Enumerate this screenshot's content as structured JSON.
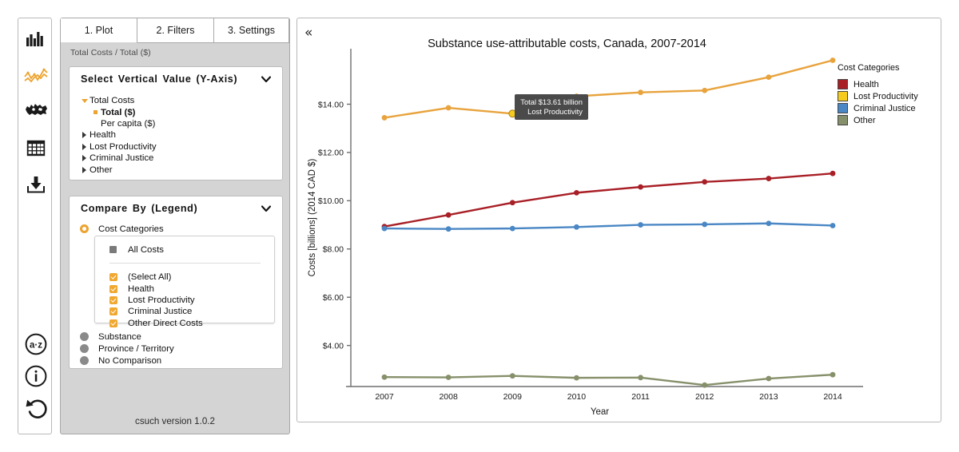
{
  "toolbar": {
    "items": [
      {
        "name": "bar-chart-icon",
        "label": "Bar chart",
        "active": false
      },
      {
        "name": "line-chart-icon",
        "label": "Line chart",
        "active": true
      },
      {
        "name": "map-icon",
        "label": "Map",
        "active": false
      },
      {
        "name": "table-icon",
        "label": "Table",
        "active": false
      },
      {
        "name": "download-icon",
        "label": "Download",
        "active": false
      },
      {
        "name": "glossary-a-z-icon",
        "label": "a-z",
        "active": false
      },
      {
        "name": "info-icon",
        "label": "Information",
        "active": false
      },
      {
        "name": "reset-icon",
        "label": "Reset",
        "active": false
      }
    ]
  },
  "sidebar": {
    "tabs": [
      {
        "label": "1. Plot",
        "active": true
      },
      {
        "label": "2. Filters",
        "active": false
      },
      {
        "label": "3. Settings",
        "active": false
      }
    ],
    "breadcrumb": "Total Costs / Total ($)",
    "yaxis_card": {
      "title": "Select Vertical Value (Y-Axis)",
      "chevron": "chevron-down",
      "tree": [
        {
          "label": "Total Costs",
          "level": 1,
          "marker": "triangle-down",
          "selected": false
        },
        {
          "label": "Total ($)",
          "level": 2,
          "marker": "square-orange",
          "selected": true
        },
        {
          "label": "Per capita ($)",
          "level": 2,
          "marker": "none",
          "selected": false
        },
        {
          "label": "Health",
          "level": 1,
          "marker": "triangle-right",
          "selected": false
        },
        {
          "label": "Lost Productivity",
          "level": 1,
          "marker": "triangle-right",
          "selected": false
        },
        {
          "label": "Criminal Justice",
          "level": 1,
          "marker": "triangle-right",
          "selected": false
        },
        {
          "label": "Other",
          "level": 1,
          "marker": "triangle-right",
          "selected": false
        }
      ]
    },
    "legend_card": {
      "title": "Compare By (Legend)",
      "chevron": "chevron-down",
      "options": [
        {
          "label": "Cost Categories",
          "selected": true
        },
        {
          "label": "Substance",
          "selected": false
        },
        {
          "label": "Province / Territory",
          "selected": false
        },
        {
          "label": "No Comparison",
          "selected": false
        }
      ],
      "subpanel": {
        "all_costs_label": "All Costs",
        "checkboxes": [
          {
            "label": "(Select All)",
            "checked": true
          },
          {
            "label": "Health",
            "checked": true
          },
          {
            "label": "Lost Productivity",
            "checked": true
          },
          {
            "label": "Criminal Justice",
            "checked": true
          },
          {
            "label": "Other Direct Costs",
            "checked": true
          }
        ]
      }
    },
    "version": "csuch version 1.0.2"
  },
  "chart_panel": {
    "collapse_label": "«",
    "legend_title": "Cost Categories",
    "tooltip": {
      "line1": "Total $13.61 billion",
      "line2": "Lost Productivity"
    }
  },
  "chart_data": {
    "type": "line",
    "title": "Substance use-attributable costs, Canada, 2007-2014",
    "xlabel": "Year",
    "ylabel": "Costs [billions] (2014 CAD $)",
    "categories": [
      2007,
      2008,
      2009,
      2010,
      2011,
      2012,
      2013,
      2014
    ],
    "x_tick_labels": [
      "2007",
      "2008",
      "2009",
      "2010",
      "2011",
      "2012",
      "2013",
      "2014"
    ],
    "y_tick_values": [
      4,
      6,
      8,
      10,
      12,
      14
    ],
    "y_tick_labels": [
      "$4.00",
      "$6.00",
      "$8.00",
      "$10.00",
      "$12.00",
      "$14.00"
    ],
    "ylim": [
      2.3,
      16.3
    ],
    "grid": false,
    "legend_position": "right",
    "series": [
      {
        "name": "Health",
        "color": "#a81f26",
        "values": [
          8.93,
          9.41,
          9.92,
          10.33,
          10.57,
          10.78,
          10.92,
          11.13
        ]
      },
      {
        "name": "Lost Productivity",
        "color": "#e8a33d",
        "values": [
          13.44,
          13.85,
          13.61,
          14.33,
          14.49,
          14.57,
          15.12,
          15.82
        ]
      },
      {
        "name": "Criminal Justice",
        "color": "#4a87c4",
        "values": [
          8.85,
          8.83,
          8.85,
          8.91,
          9.0,
          9.02,
          9.06,
          8.97
        ]
      },
      {
        "name": "Other",
        "color": "#86906a",
        "values": [
          2.69,
          2.68,
          2.74,
          2.66,
          2.67,
          2.36,
          2.63,
          2.79
        ]
      }
    ]
  }
}
